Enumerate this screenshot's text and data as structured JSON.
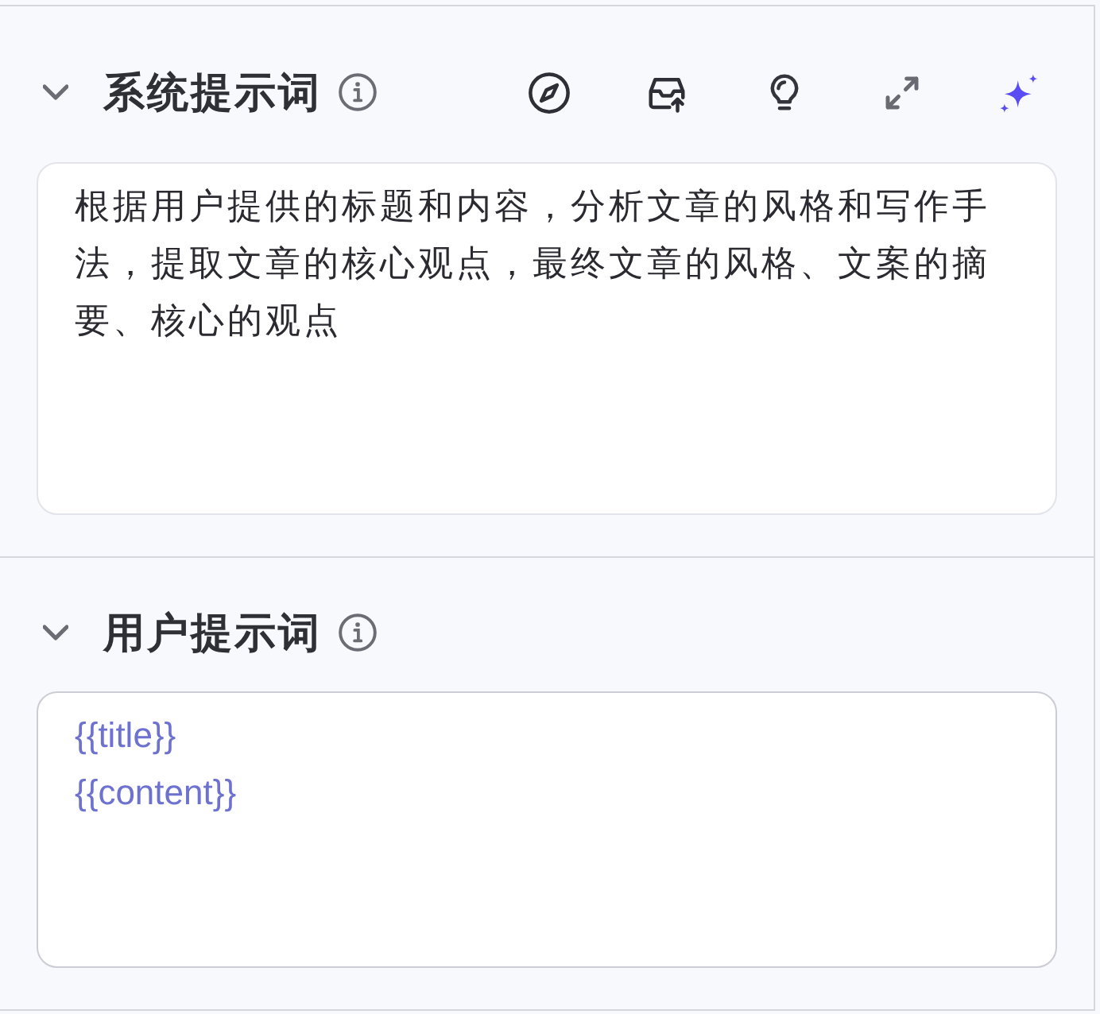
{
  "sections": [
    {
      "title": "系统提示词",
      "expanded": true,
      "toolbar": true,
      "kind": "text",
      "value": "根据用户提供的标题和内容，分析文章的风格和写作手法，提取文章的核心观点，最终文章的风格、文案的摘要、核心的观点"
    },
    {
      "title": "用户提示词",
      "expanded": true,
      "toolbar": false,
      "kind": "template",
      "value": "{{title}}\n{{content}}"
    }
  ]
}
